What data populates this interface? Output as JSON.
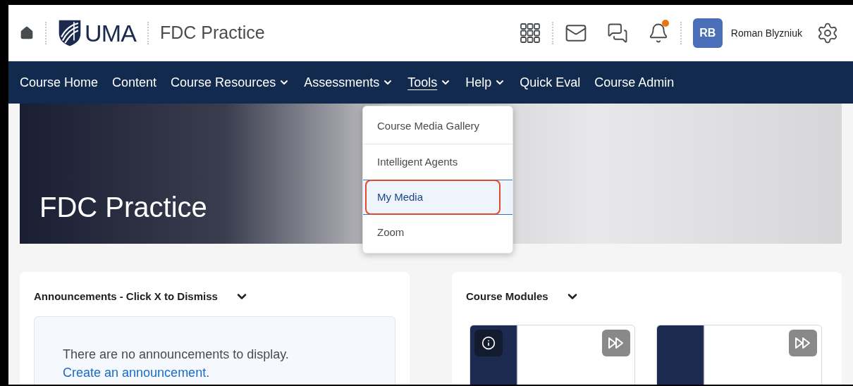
{
  "header": {
    "logo_text": "UMA",
    "course_title": "FDC Practice",
    "notifications_unread": true,
    "user": {
      "initials": "RB",
      "name": "Roman Blyzniuk"
    }
  },
  "nav": [
    {
      "label": "Course Home",
      "dropdown": false,
      "selected": false
    },
    {
      "label": "Content",
      "dropdown": false,
      "selected": false
    },
    {
      "label": "Course Resources",
      "dropdown": true,
      "selected": false
    },
    {
      "label": "Assessments",
      "dropdown": true,
      "selected": false
    },
    {
      "label": "Tools",
      "dropdown": true,
      "selected": true
    },
    {
      "label": "Help",
      "dropdown": true,
      "selected": false
    },
    {
      "label": "Quick Eval",
      "dropdown": false,
      "selected": false
    },
    {
      "label": "Course Admin",
      "dropdown": false,
      "selected": false
    }
  ],
  "tools_menu": [
    {
      "label": "Course Media Gallery",
      "selected": false
    },
    {
      "label": "Intelligent Agents",
      "selected": false
    },
    {
      "label": "My Media",
      "selected": true,
      "annotated": true
    },
    {
      "label": "Zoom",
      "selected": false
    }
  ],
  "banner": {
    "title": "FDC Practice"
  },
  "announcements": {
    "title": "Announcements - Click X to Dismiss",
    "message": "There are no announcements to display.",
    "link": "Create an announcement."
  },
  "course_modules": {
    "title": "Course Modules",
    "tiles": [
      {
        "info": true
      },
      {
        "info": false
      }
    ]
  }
}
